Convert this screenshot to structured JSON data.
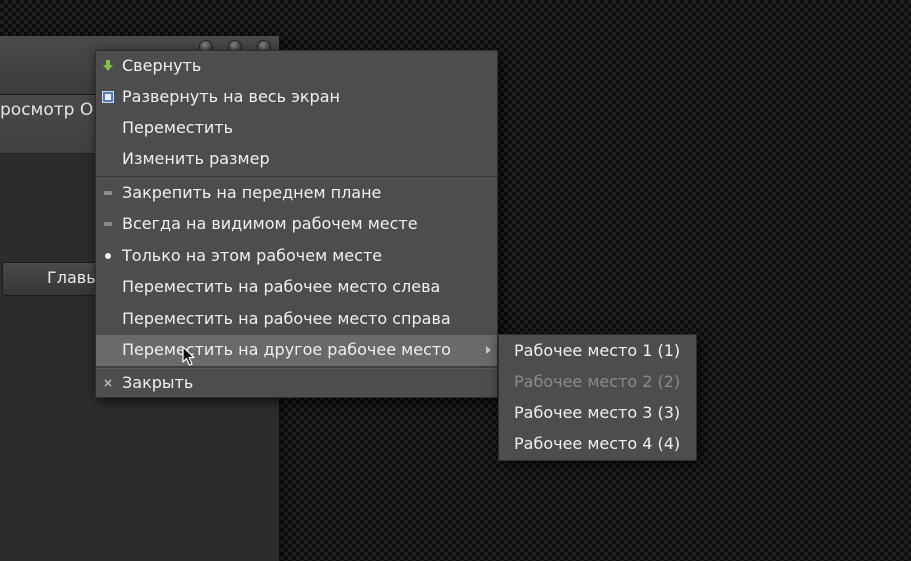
{
  "background_window": {
    "menu_text": "росмотр  О",
    "button_label": "Главы"
  },
  "context_menu": {
    "items": [
      {
        "label": "Свернуть",
        "icon": "minimize-arrow-icon",
        "icon_color": "#7ec24a"
      },
      {
        "label": "Развернуть на весь экран",
        "icon": "maximize-icon",
        "icon_color": "#9fb9e6"
      },
      {
        "label": "Переместить",
        "icon": ""
      },
      {
        "label": "Изменить размер",
        "icon": ""
      },
      {
        "label": "Закрепить на переднем плане",
        "icon": "unchecked-dash-icon"
      },
      {
        "label": "Всегда на видимом рабочем месте",
        "icon": "unchecked-dash-icon"
      },
      {
        "label": "Только на этом рабочем месте",
        "icon": "radio-selected-dot-icon"
      },
      {
        "label": "Переместить на рабочее место слева",
        "icon": ""
      },
      {
        "label": "Переместить на рабочее место справа",
        "icon": ""
      },
      {
        "label": "Переместить на другое рабочее место",
        "icon": "",
        "has_submenu": true,
        "highlighted": true
      },
      {
        "label": "Закрыть",
        "icon": "close-x-icon"
      }
    ]
  },
  "submenu": {
    "items": [
      {
        "label": "Рабочее место 1 (1)",
        "enabled": true
      },
      {
        "label": "Рабочее место 2 (2)",
        "enabled": false
      },
      {
        "label": "Рабочее место 3 (3)",
        "enabled": true
      },
      {
        "label": "Рабочее место 4 (4)",
        "enabled": true
      }
    ]
  }
}
